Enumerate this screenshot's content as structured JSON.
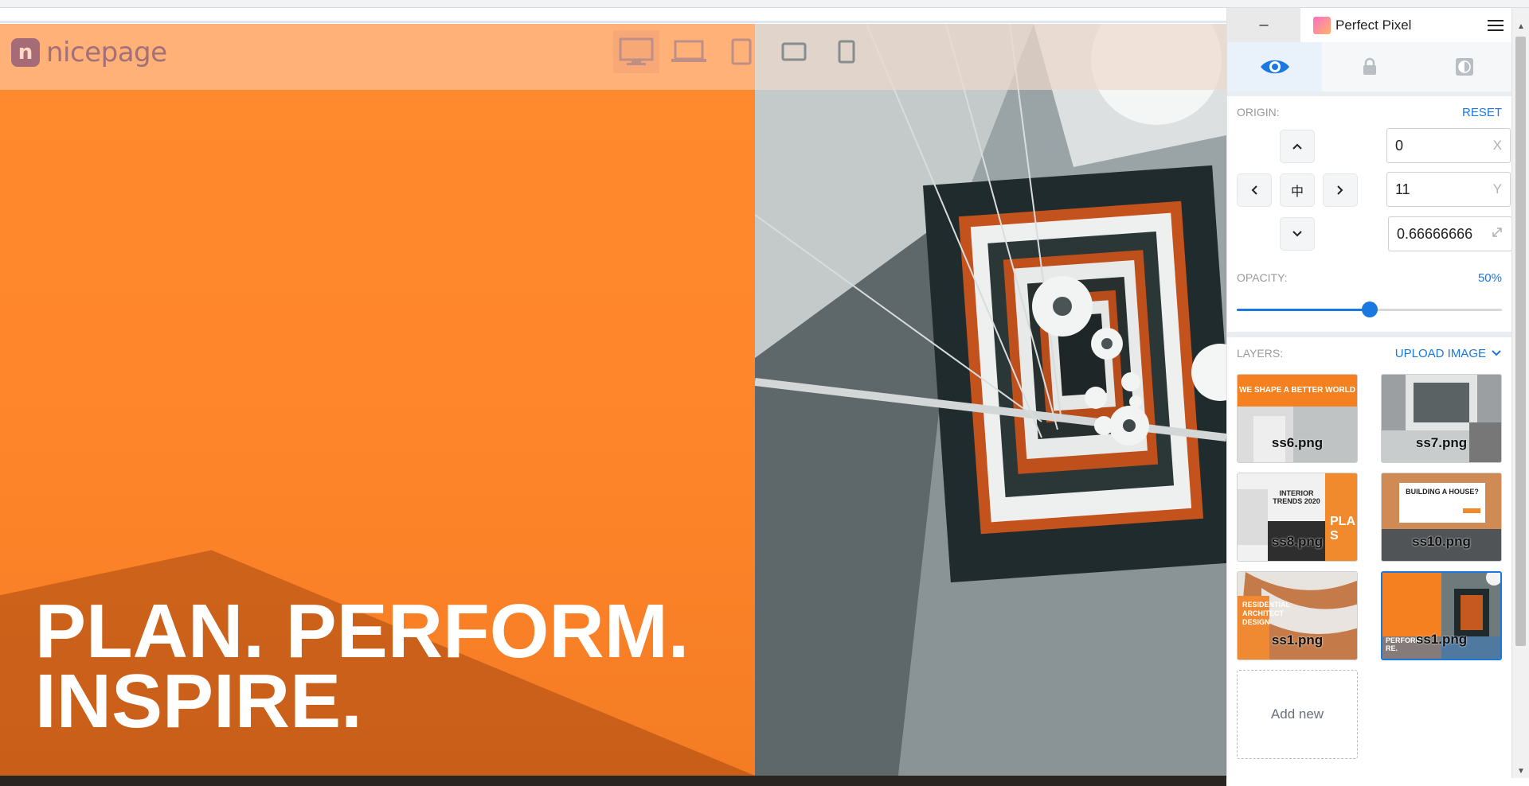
{
  "page": {
    "brand_name": "nicepage",
    "brand_mark": "n",
    "hero_line1": "PLAN. PERFORM.",
    "hero_line2": "INSPIRE.",
    "devices": [
      "desktop-icon",
      "laptop-icon",
      "tablet-icon",
      "tablet-landscape-icon",
      "phone-icon"
    ]
  },
  "panel": {
    "minimize": "–",
    "title": "Perfect Pixel",
    "tabs": [
      "eye-icon",
      "lock-icon",
      "invert-icon"
    ],
    "origin_label": "ORIGIN:",
    "reset_label": "RESET",
    "center_glyph": "中",
    "x_value": "0",
    "x_suffix": "X",
    "y_value": "11",
    "y_suffix": "Y",
    "scale_value": "0.66666666",
    "opacity_label": "OPACITY:",
    "opacity_value": "50%",
    "opacity_fraction": 0.5,
    "layers_label": "LAYERS:",
    "upload_label": "UPLOAD IMAGE",
    "layers": [
      {
        "name": "ss6.png",
        "heading": "WE SHAPE A BETTER WORLD"
      },
      {
        "name": "ss7.png"
      },
      {
        "name": "ss8.png",
        "heading": "INTERIOR TRENDS 2020",
        "side": "PLA S"
      },
      {
        "name": "ss10.png",
        "heading": "BUILDING A HOUSE?"
      },
      {
        "name": "ss1.png",
        "heading": "RESIDENTIAL ARCHITECT DESIGN"
      },
      {
        "name": "ss1.png",
        "heading": "PERFORM RE.",
        "selected": true
      }
    ],
    "add_new": "Add new"
  },
  "colors": {
    "accent": "#1a78e0",
    "orange": "#ff8a2e"
  }
}
